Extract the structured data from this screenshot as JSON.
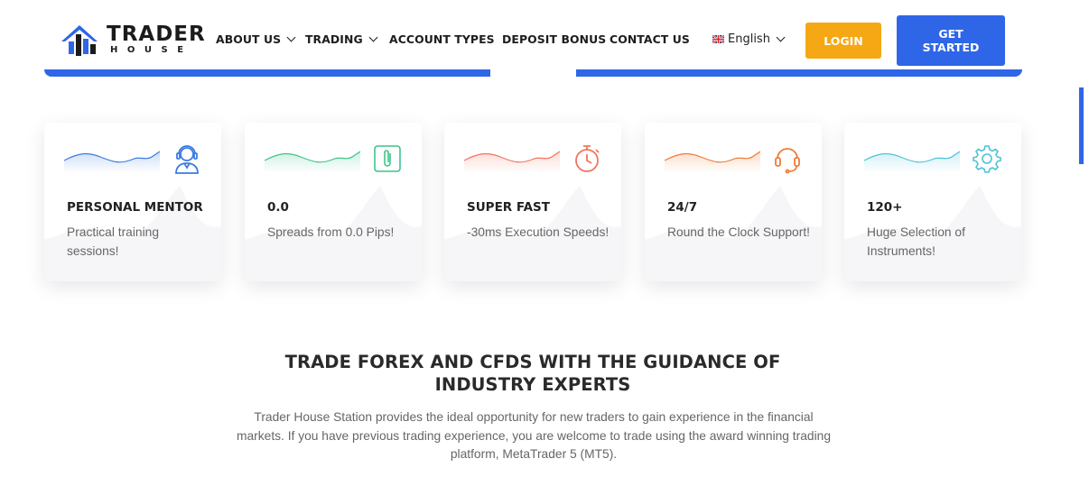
{
  "brand": {
    "logo_word": "TRADER",
    "logo_sub": "HOUSE"
  },
  "nav": {
    "items": [
      {
        "label": "ABOUT US",
        "has_dropdown": true
      },
      {
        "label": "TRADING",
        "has_dropdown": true
      },
      {
        "label": "ACCOUNT TYPES",
        "has_dropdown": false
      },
      {
        "label": "DEPOSIT BONUS",
        "has_dropdown": false
      },
      {
        "label": "CONTACT US",
        "has_dropdown": false
      }
    ],
    "language": "English",
    "login_label": "LOGIN",
    "get_started_line1": "GET",
    "get_started_line2": "STARTED"
  },
  "colors": {
    "primary_blue": "#2f66e8",
    "login_orange": "#f5a814"
  },
  "features": [
    {
      "title": "PERSONAL MENTOR",
      "desc": "Practical training sessions!",
      "icon": "support-agent-icon",
      "color": "#3b7be0"
    },
    {
      "title": "0.0",
      "desc": "Spreads from 0.0 Pips!",
      "icon": "paperclip-icon",
      "color": "#3ec48a"
    },
    {
      "title": "SUPER FAST",
      "desc": "-30ms Execution Speeds!",
      "icon": "stopwatch-icon",
      "color": "#f2745c"
    },
    {
      "title": "24/7",
      "desc": "Round the Clock Support!",
      "icon": "headset-icon",
      "color": "#f07a35"
    },
    {
      "title": "120+",
      "desc": "Huge Selection of Instruments!",
      "icon": "gear-icon",
      "color": "#4ec1d6"
    }
  ],
  "section": {
    "title_line1": "TRADE FOREX AND CFDS WITH THE GUIDANCE OF",
    "title_line2": "INDUSTRY EXPERTS",
    "body": "Trader House Station provides the ideal opportunity for new traders to gain experience in the financial markets. If you have previous trading experience, you are welcome to trade using the award winning trading platform, MetaTrader 5 (MT5)."
  }
}
